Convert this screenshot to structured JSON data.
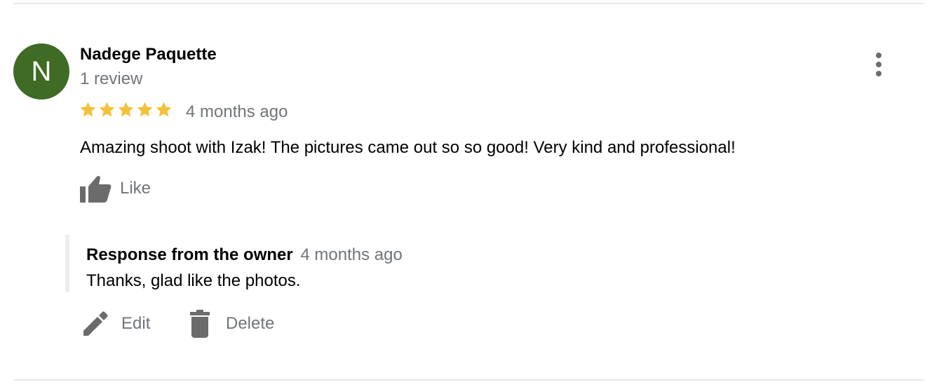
{
  "review": {
    "avatar_initial": "N",
    "reviewer_name": "Nadege Paquette",
    "review_count": "1 review",
    "rating": 5,
    "rating_max": 5,
    "date": "4 months ago",
    "text": "Amazing shoot with Izak! The pictures came out so so good! Very kind and professional!",
    "like_label": "Like"
  },
  "owner_response": {
    "author": "Response from the owner",
    "date": "4 months ago",
    "text": "Thanks, glad like the photos."
  },
  "actions": {
    "edit_label": "Edit",
    "delete_label": "Delete"
  },
  "icons": {
    "more": "more-vert-icon",
    "star": "star-icon",
    "like": "thumb-up-icon",
    "edit": "pencil-icon",
    "delete": "trash-icon"
  },
  "colors": {
    "avatar": "#3f6b24",
    "star": "#f4c13a",
    "icon": "#6b6b6b",
    "muted_text": "#70757a"
  }
}
